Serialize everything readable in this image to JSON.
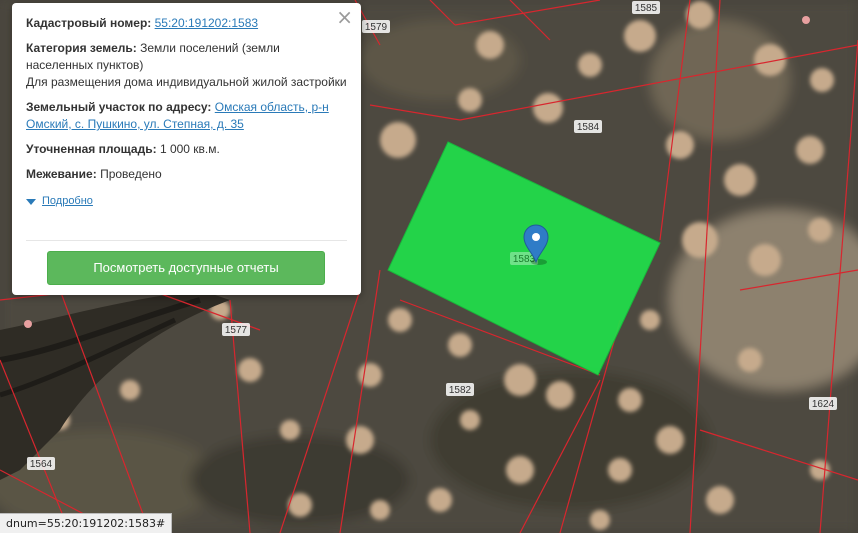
{
  "popup": {
    "close_glyph": "×",
    "cadastral_label": "Кадастровый номер:",
    "cadastral_number": "55:20:191202:1583",
    "category_label": "Категория земель:",
    "category_value": "Земли поселений (земли населенных пунктов)",
    "usage_value": "Для размещения дома индивидуальной жилой застройки",
    "address_label": "Земельный участок по адресу:",
    "address_value": "Омская область, р-н Омский, с. Пушкино, ул. Степная, д. 35",
    "area_label": "Уточненная площадь:",
    "area_value": "1 000 кв.м.",
    "survey_label": "Межевание:",
    "survey_value": "Проведено",
    "details_label": "Подробно",
    "reports_button": "Посмотреть доступные отчеты"
  },
  "map": {
    "parcel_color": "#1fe04a",
    "boundary_color": "#d8262e",
    "labels": {
      "p1579": "1579",
      "p1585": "1585",
      "p1584": "1584",
      "p1583": "1583",
      "p1577": "1577",
      "p1582": "1582",
      "p1624": "1624",
      "p1564": "1564"
    }
  },
  "status_bar": {
    "text": "dnum=55:20:191202:1583#"
  }
}
